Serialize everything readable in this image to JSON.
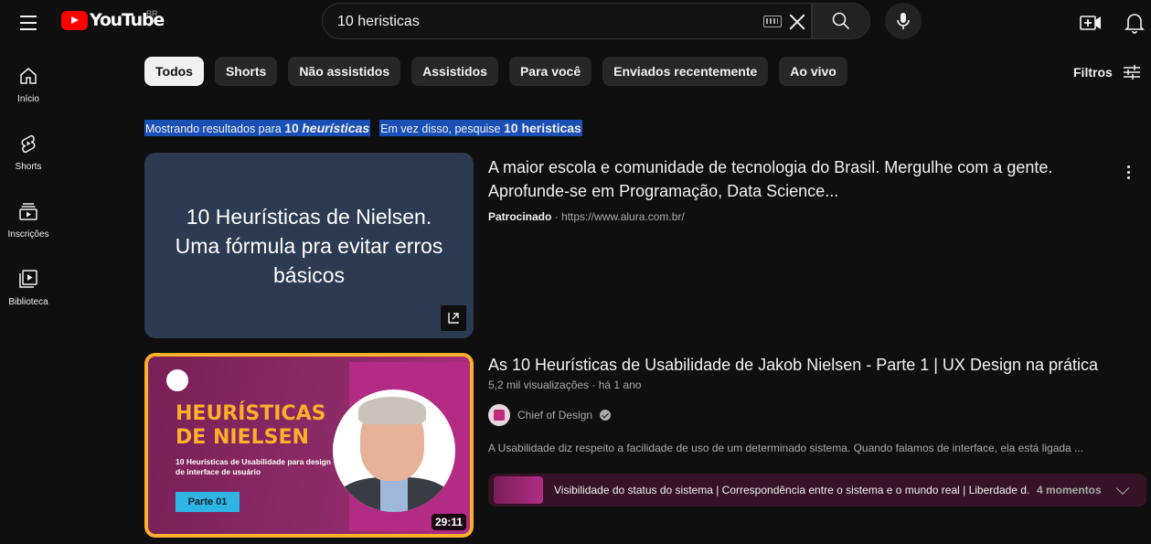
{
  "header": {
    "logo_text": "YouTube",
    "country": "BR",
    "search_query": "10 heristicas"
  },
  "sidebar": {
    "items": [
      {
        "label": "Início",
        "icon": "home-icon"
      },
      {
        "label": "Shorts",
        "icon": "shorts-icon"
      },
      {
        "label": "Inscrições",
        "icon": "subscriptions-icon"
      },
      {
        "label": "Biblioteca",
        "icon": "library-icon"
      }
    ]
  },
  "chips": [
    "Todos",
    "Shorts",
    "Não assistidos",
    "Assistidos",
    "Para você",
    "Enviados recentemente",
    "Ao vivo"
  ],
  "filters_label": "Filtros",
  "correction": {
    "showing_prefix": "Mostrando resultados para",
    "showing_num": "10",
    "showing_word": "heurísticas",
    "instead_prefix": "Em vez disso, pesquise",
    "instead_query": "10 heristicas"
  },
  "ad": {
    "thumb_text": "10 Heurísticas de Nielsen. Uma fórmula pra evitar erros básicos",
    "title": "A maior escola e comunidade de tecnologia do Brasil. Mergulhe com a gente. Aprofunde-se em Programação, Data Science...",
    "sponsored": "Patrocinado",
    "url": "https://www.alura.com.br/"
  },
  "video": {
    "thumb_title_line1": "HEURÍSTICAS",
    "thumb_title_line2": "DE NIELSEN",
    "thumb_subtitle": "10 Heurísticas de Usabilidade para design de interface de usuário",
    "thumb_part": "Parte 01",
    "duration": "29:11",
    "title": "As 10 Heurísticas de Usabilidade de Jakob Nielsen - Parte 1 | UX Design na prática",
    "views": "5,2 mil visualizações",
    "age": "há 1 ano",
    "channel": "Chief of Design",
    "description": "A Usabilidade diz respeito a facilidade de uso de um determinado sistema. Quando falamos de interface, ela está ligada ...",
    "moments_text": "Visibilidade do status do sistema | Correspondência entre o sistema e o mundo real | Liberdade d...",
    "moments_count": "4 momentos"
  },
  "colors": {
    "background": "#0f0f0f",
    "brand_red": "#ff0000",
    "highlight_blue": "#1a4fb5",
    "thumb_border": "#fbb02a"
  }
}
